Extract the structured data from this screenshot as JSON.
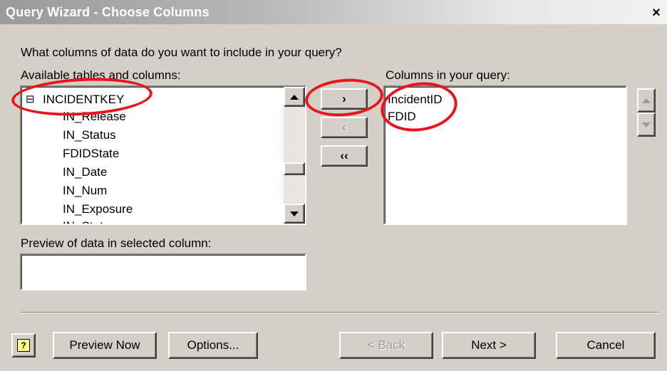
{
  "window": {
    "title": "Query Wizard - Choose Columns",
    "close_glyph": "×"
  },
  "prompt": "What columns of data do you want to include in your query?",
  "available": {
    "label": "Available tables and columns:",
    "table_name": "INCIDENTKEY",
    "expander": "⊟",
    "columns": [
      "IN_Release",
      "IN_Status",
      "FDIDState",
      "IN_Date",
      "IN_Num",
      "IN_Exposure",
      "IN_Status"
    ]
  },
  "move_buttons": {
    "add": "›",
    "remove": "‹",
    "remove_all": "‹‹"
  },
  "query_columns": {
    "label": "Columns in your query:",
    "items": [
      "IncidentID",
      "FDID"
    ]
  },
  "preview": {
    "label": "Preview of data in selected column:",
    "value": ""
  },
  "footer": {
    "help_glyph": "?",
    "preview_now": "Preview Now",
    "options": "Options...",
    "back": "< Back",
    "next": "Next >",
    "cancel": "Cancel"
  },
  "colors": {
    "annotation_ring": "#e8161c",
    "dialog_bg": "#d4d0c8"
  }
}
